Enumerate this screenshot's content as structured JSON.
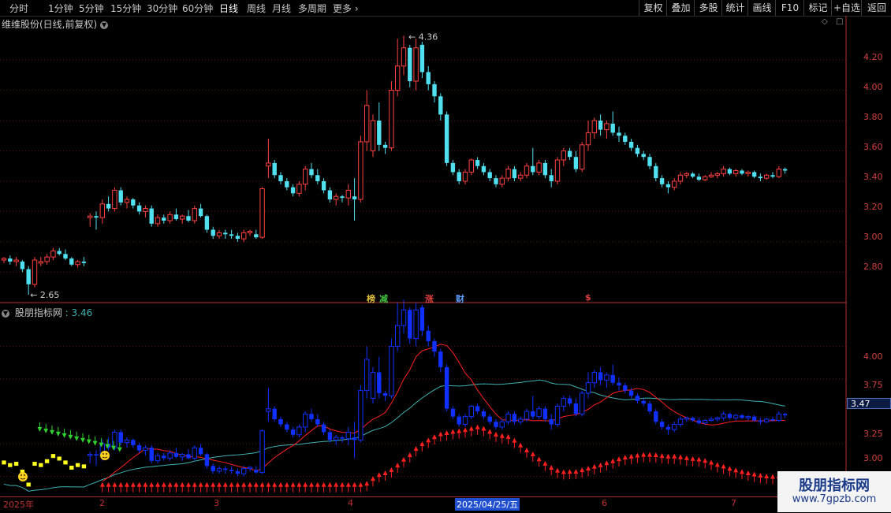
{
  "toolbar": {
    "periods": [
      "分时",
      "1分钟",
      "5分钟",
      "15分钟",
      "30分钟",
      "60分钟",
      "日线",
      "周线",
      "月线",
      "多周期",
      "更多"
    ],
    "active_period": "日线",
    "tools": [
      "复权",
      "叠加",
      "多股",
      "统计",
      "画线",
      "F10",
      "标记",
      "+自选",
      "返回"
    ]
  },
  "main_panel": {
    "title": "维维股份(日线,前复权)",
    "high_label": "4.36",
    "low_label": "2.65",
    "price_ticks": [
      "4.20",
      "4.00",
      "3.80",
      "3.60",
      "3.40",
      "3.20",
      "3.00",
      "2.80"
    ],
    "markers": [
      {
        "text": "榜",
        "color": "#e0c040"
      },
      {
        "text": "减",
        "color": "#40c040"
      },
      {
        "text": "涨",
        "color": "#e04040"
      },
      {
        "text": "财",
        "color": "#60a0ff"
      },
      {
        "text": "$",
        "color": "#e04040"
      }
    ]
  },
  "indicator_panel": {
    "title": "股朋指标网",
    "value": "3.46",
    "ticks": [
      "4.00",
      "3.75",
      "3.25",
      "3.00"
    ],
    "current": "3.47"
  },
  "date_axis": {
    "ticks": [
      "2025年",
      "2",
      "3",
      "4",
      "2025/04/25/五",
      "6",
      "7"
    ]
  },
  "watermark": {
    "title": "股朋指标网",
    "url": "www.7gpzb.com"
  },
  "colors": {
    "up": "#ff4040",
    "down": "#50e0f0",
    "ind_blue": "#1030ff",
    "ma_red": "#ff2020",
    "ma_teal": "#40b0b0",
    "green_arrow": "#30d030",
    "yellow_bar": "#ffff20"
  },
  "chart_data": {
    "type": "candlestick",
    "x": [
      "2025-01-02",
      "2025-01-03",
      "2025-01-06",
      "2025-01-07",
      "2025-01-08",
      "2025-01-09",
      "2025-01-10",
      "2025-01-13",
      "2025-01-14",
      "2025-01-15",
      "2025-01-16",
      "2025-01-17",
      "2025-01-20",
      "2025-01-21",
      "2025-01-22",
      "2025-01-23",
      "2025-01-24",
      "2025-01-27",
      "2025-02-05",
      "2025-02-06",
      "2025-02-07",
      "2025-02-10",
      "2025-02-11",
      "2025-02-12",
      "2025-02-13",
      "2025-02-14",
      "2025-02-17",
      "2025-02-18",
      "2025-02-19",
      "2025-02-20",
      "2025-02-21",
      "2025-02-24",
      "2025-02-25",
      "2025-02-26",
      "2025-02-27",
      "2025-02-28",
      "2025-03-03",
      "2025-03-04",
      "2025-03-05",
      "2025-03-06",
      "2025-03-07",
      "2025-03-10",
      "2025-03-11",
      "2025-03-12",
      "2025-03-13",
      "2025-03-14",
      "2025-03-17",
      "2025-03-18",
      "2025-03-19",
      "2025-03-20",
      "2025-03-21",
      "2025-03-24",
      "2025-03-25",
      "2025-03-26",
      "2025-03-27",
      "2025-03-28",
      "2025-03-31",
      "2025-04-01",
      "2025-04-02",
      "2025-04-03",
      "2025-04-07",
      "2025-04-08",
      "2025-04-09",
      "2025-04-10",
      "2025-04-11",
      "2025-04-14",
      "2025-04-15",
      "2025-04-16",
      "2025-04-17",
      "2025-04-18",
      "2025-04-21",
      "2025-04-22",
      "2025-04-23",
      "2025-04-24",
      "2025-04-25",
      "2025-04-28",
      "2025-04-29",
      "2025-04-30",
      "2025-05-06",
      "2025-05-07",
      "2025-05-08",
      "2025-05-09",
      "2025-05-12",
      "2025-05-13",
      "2025-05-14",
      "2025-05-15",
      "2025-05-16",
      "2025-05-19",
      "2025-05-20",
      "2025-05-21",
      "2025-05-22",
      "2025-05-23",
      "2025-05-26",
      "2025-05-27",
      "2025-05-28",
      "2025-05-29",
      "2025-05-30",
      "2025-06-03",
      "2025-06-04",
      "2025-06-05",
      "2025-06-06",
      "2025-06-09",
      "2025-06-10",
      "2025-06-11",
      "2025-06-12",
      "2025-06-13",
      "2025-06-16",
      "2025-06-17",
      "2025-06-18",
      "2025-06-19",
      "2025-06-20",
      "2025-06-23",
      "2025-06-24",
      "2025-06-25",
      "2025-06-26",
      "2025-06-27",
      "2025-06-30",
      "2025-07-01",
      "2025-07-02",
      "2025-07-03",
      "2025-07-04",
      "2025-07-07",
      "2025-07-08",
      "2025-07-09",
      "2025-07-10",
      "2025-07-11",
      "2025-07-14",
      "2025-07-15",
      "2025-07-16",
      "2025-07-17",
      "2025-07-18",
      "2025-07-21",
      "2025-07-22",
      "2025-07-23",
      "2025-07-24",
      "2025-07-25"
    ],
    "ohlc": [
      [
        2.88,
        2.9,
        2.86,
        2.89
      ],
      [
        2.89,
        2.91,
        2.85,
        2.87
      ],
      [
        2.87,
        2.9,
        2.84,
        2.88
      ],
      [
        2.87,
        2.88,
        2.8,
        2.82
      ],
      [
        2.82,
        2.84,
        2.65,
        2.72
      ],
      [
        2.72,
        2.9,
        2.7,
        2.88
      ],
      [
        2.86,
        2.9,
        2.84,
        2.87
      ],
      [
        2.87,
        2.92,
        2.85,
        2.9
      ],
      [
        2.9,
        2.96,
        2.88,
        2.94
      ],
      [
        2.94,
        2.96,
        2.91,
        2.92
      ],
      [
        2.92,
        2.95,
        2.88,
        2.89
      ],
      [
        2.89,
        2.9,
        2.84,
        2.85
      ],
      [
        2.85,
        2.88,
        2.83,
        2.87
      ],
      [
        2.87,
        2.9,
        2.84,
        2.86
      ],
      [
        3.16,
        3.19,
        3.1,
        3.17
      ],
      [
        3.17,
        3.2,
        3.08,
        3.16
      ],
      [
        3.16,
        3.28,
        3.12,
        3.25
      ],
      [
        3.25,
        3.3,
        3.2,
        3.22
      ],
      [
        3.22,
        3.36,
        3.2,
        3.34
      ],
      [
        3.34,
        3.36,
        3.24,
        3.26
      ],
      [
        3.26,
        3.3,
        3.22,
        3.28
      ],
      [
        3.28,
        3.29,
        3.22,
        3.24
      ],
      [
        3.24,
        3.26,
        3.18,
        3.2
      ],
      [
        3.2,
        3.24,
        3.16,
        3.22
      ],
      [
        3.22,
        3.24,
        3.1,
        3.12
      ],
      [
        3.12,
        3.18,
        3.1,
        3.16
      ],
      [
        3.16,
        3.18,
        3.12,
        3.14
      ],
      [
        3.14,
        3.2,
        3.12,
        3.18
      ],
      [
        3.18,
        3.22,
        3.14,
        3.15
      ],
      [
        3.15,
        3.18,
        3.12,
        3.17
      ],
      [
        3.17,
        3.21,
        3.13,
        3.14
      ],
      [
        3.14,
        3.24,
        3.12,
        3.22
      ],
      [
        3.22,
        3.25,
        3.16,
        3.17
      ],
      [
        3.17,
        3.18,
        3.06,
        3.08
      ],
      [
        3.08,
        3.1,
        3.02,
        3.04
      ],
      [
        3.04,
        3.08,
        3.02,
        3.06
      ],
      [
        3.06,
        3.08,
        3.02,
        3.05
      ],
      [
        3.05,
        3.08,
        3.02,
        3.04
      ],
      [
        3.04,
        3.06,
        3.0,
        3.02
      ],
      [
        3.02,
        3.08,
        3.0,
        3.06
      ],
      [
        3.06,
        3.08,
        3.04,
        3.07
      ],
      [
        3.05,
        3.08,
        3.02,
        3.03
      ],
      [
        3.03,
        3.36,
        3.02,
        3.35
      ],
      [
        3.5,
        3.68,
        3.42,
        3.52
      ],
      [
        3.52,
        3.54,
        3.42,
        3.44
      ],
      [
        3.44,
        3.46,
        3.38,
        3.4
      ],
      [
        3.4,
        3.42,
        3.34,
        3.36
      ],
      [
        3.36,
        3.38,
        3.3,
        3.32
      ],
      [
        3.32,
        3.4,
        3.3,
        3.38
      ],
      [
        3.38,
        3.5,
        3.34,
        3.48
      ],
      [
        3.48,
        3.52,
        3.42,
        3.44
      ],
      [
        3.44,
        3.48,
        3.38,
        3.4
      ],
      [
        3.4,
        3.42,
        3.32,
        3.34
      ],
      [
        3.34,
        3.36,
        3.26,
        3.28
      ],
      [
        3.28,
        3.32,
        3.24,
        3.3
      ],
      [
        3.3,
        3.31,
        3.26,
        3.29
      ],
      [
        3.29,
        3.38,
        3.24,
        3.34
      ],
      [
        3.3,
        3.42,
        3.14,
        3.28
      ],
      [
        3.28,
        3.7,
        3.26,
        3.66
      ],
      [
        3.66,
        4.0,
        3.6,
        3.9
      ],
      [
        3.6,
        3.84,
        3.56,
        3.8
      ],
      [
        3.8,
        3.92,
        3.6,
        3.64
      ],
      [
        3.64,
        3.66,
        3.58,
        3.62
      ],
      [
        3.62,
        4.06,
        3.6,
        4.0
      ],
      [
        4.0,
        4.34,
        3.96,
        4.16
      ],
      [
        4.16,
        4.36,
        4.1,
        4.28
      ],
      [
        4.28,
        4.3,
        4.02,
        4.06
      ],
      [
        4.06,
        4.34,
        4.0,
        4.28
      ],
      [
        4.3,
        4.32,
        4.08,
        4.12
      ],
      [
        4.12,
        4.16,
        4.0,
        4.04
      ],
      [
        4.04,
        4.06,
        3.92,
        3.96
      ],
      [
        3.96,
        3.98,
        3.8,
        3.84
      ],
      [
        3.84,
        3.86,
        3.5,
        3.52
      ],
      [
        3.52,
        3.54,
        3.44,
        3.46
      ],
      [
        3.46,
        3.48,
        3.38,
        3.4
      ],
      [
        3.4,
        3.48,
        3.38,
        3.46
      ],
      [
        3.46,
        3.55,
        3.44,
        3.54
      ],
      [
        3.54,
        3.56,
        3.48,
        3.5
      ],
      [
        3.5,
        3.52,
        3.44,
        3.46
      ],
      [
        3.46,
        3.48,
        3.4,
        3.42
      ],
      [
        3.42,
        3.44,
        3.36,
        3.38
      ],
      [
        3.38,
        3.44,
        3.36,
        3.42
      ],
      [
        3.42,
        3.5,
        3.4,
        3.48
      ],
      [
        3.48,
        3.5,
        3.4,
        3.42
      ],
      [
        3.42,
        3.46,
        3.4,
        3.44
      ],
      [
        3.44,
        3.52,
        3.42,
        3.5
      ],
      [
        3.5,
        3.62,
        3.44,
        3.46
      ],
      [
        3.46,
        3.54,
        3.44,
        3.52
      ],
      [
        3.52,
        3.54,
        3.42,
        3.44
      ],
      [
        3.44,
        3.48,
        3.36,
        3.4
      ],
      [
        3.4,
        3.56,
        3.38,
        3.54
      ],
      [
        3.54,
        3.62,
        3.5,
        3.6
      ],
      [
        3.6,
        3.62,
        3.54,
        3.56
      ],
      [
        3.56,
        3.6,
        3.46,
        3.48
      ],
      [
        3.48,
        3.66,
        3.46,
        3.64
      ],
      [
        3.64,
        3.8,
        3.6,
        3.72
      ],
      [
        3.72,
        3.82,
        3.68,
        3.8
      ],
      [
        3.8,
        3.84,
        3.7,
        3.74
      ],
      [
        3.74,
        3.8,
        3.68,
        3.78
      ],
      [
        3.78,
        3.86,
        3.7,
        3.72
      ],
      [
        3.72,
        3.76,
        3.66,
        3.7
      ],
      [
        3.7,
        3.72,
        3.64,
        3.66
      ],
      [
        3.66,
        3.68,
        3.6,
        3.62
      ],
      [
        3.62,
        3.64,
        3.56,
        3.58
      ],
      [
        3.58,
        3.6,
        3.54,
        3.56
      ],
      [
        3.56,
        3.58,
        3.48,
        3.5
      ],
      [
        3.5,
        3.52,
        3.4,
        3.42
      ],
      [
        3.42,
        3.44,
        3.36,
        3.38
      ],
      [
        3.38,
        3.4,
        3.32,
        3.36
      ],
      [
        3.36,
        3.42,
        3.34,
        3.4
      ],
      [
        3.4,
        3.46,
        3.38,
        3.44
      ],
      [
        3.44,
        3.46,
        3.42,
        3.45
      ],
      [
        3.45,
        3.46,
        3.42,
        3.43
      ],
      [
        3.43,
        3.45,
        3.4,
        3.41
      ],
      [
        3.41,
        3.44,
        3.4,
        3.43
      ],
      [
        3.43,
        3.46,
        3.42,
        3.44
      ],
      [
        3.44,
        3.46,
        3.42,
        3.45
      ],
      [
        3.45,
        3.5,
        3.43,
        3.48
      ],
      [
        3.48,
        3.49,
        3.44,
        3.45
      ],
      [
        3.45,
        3.48,
        3.43,
        3.47
      ],
      [
        3.47,
        3.48,
        3.44,
        3.45
      ],
      [
        3.45,
        3.47,
        3.43,
        3.46
      ],
      [
        3.46,
        3.47,
        3.42,
        3.43
      ],
      [
        3.43,
        3.45,
        3.4,
        3.42
      ],
      [
        3.42,
        3.45,
        3.41,
        3.44
      ],
      [
        3.44,
        3.46,
        3.42,
        3.43
      ],
      [
        3.43,
        3.5,
        3.42,
        3.48
      ],
      [
        3.48,
        3.49,
        3.45,
        3.47
      ]
    ],
    "ylim": [
      2.62,
      4.45
    ],
    "indicator_ylim": [
      2.87,
      4.3
    ]
  }
}
